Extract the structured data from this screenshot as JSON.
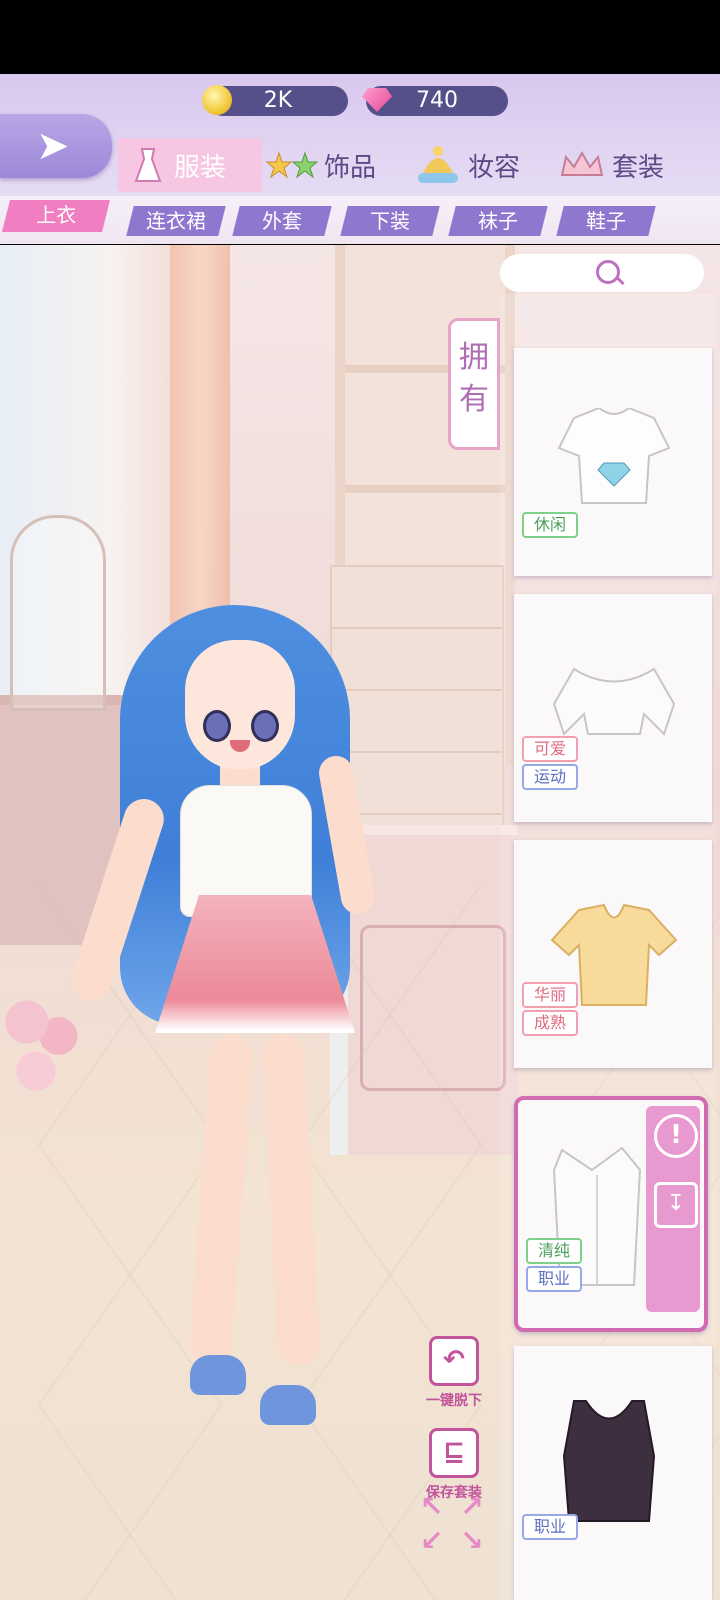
{
  "currency": {
    "coins": "2K",
    "gems": "740"
  },
  "categories": [
    {
      "label": "服装",
      "icon": "dress-icon",
      "active": true
    },
    {
      "label": "饰品",
      "icon": "stars-icon",
      "active": false
    },
    {
      "label": "妆容",
      "icon": "hat-icon",
      "active": false
    },
    {
      "label": "套装",
      "icon": "crown-icon",
      "active": false
    }
  ],
  "subtabs": [
    "上衣",
    "连衣裙",
    "外套",
    "下装",
    "袜子",
    "鞋子"
  ],
  "owned_tab": "拥有",
  "cards": [
    {
      "item": "white-tshirt-diamond",
      "tags": [
        {
          "text": "休闲",
          "color": "green"
        }
      ]
    },
    {
      "item": "white-crop-top",
      "tags": [
        {
          "text": "可爱",
          "color": "red"
        },
        {
          "text": "运动",
          "color": "blue"
        }
      ]
    },
    {
      "item": "yellow-blouse",
      "tags": [
        {
          "text": "华丽",
          "color": "red"
        },
        {
          "text": "成熟",
          "color": "red"
        }
      ]
    },
    {
      "item": "white-sleeveless-blouse",
      "tags": [
        {
          "text": "清纯",
          "color": "green"
        },
        {
          "text": "职业",
          "color": "blue"
        }
      ],
      "selected": true
    },
    {
      "item": "dark-tank-top",
      "tags": [
        {
          "text": "职业",
          "color": "blue"
        }
      ]
    }
  ],
  "actions": {
    "undress_all": "一键脱下",
    "save_outfit": "保存套装"
  },
  "colors": {
    "accent": "#f07ec0",
    "tab": "#8f77d0",
    "panel": "#d8c8ee"
  }
}
